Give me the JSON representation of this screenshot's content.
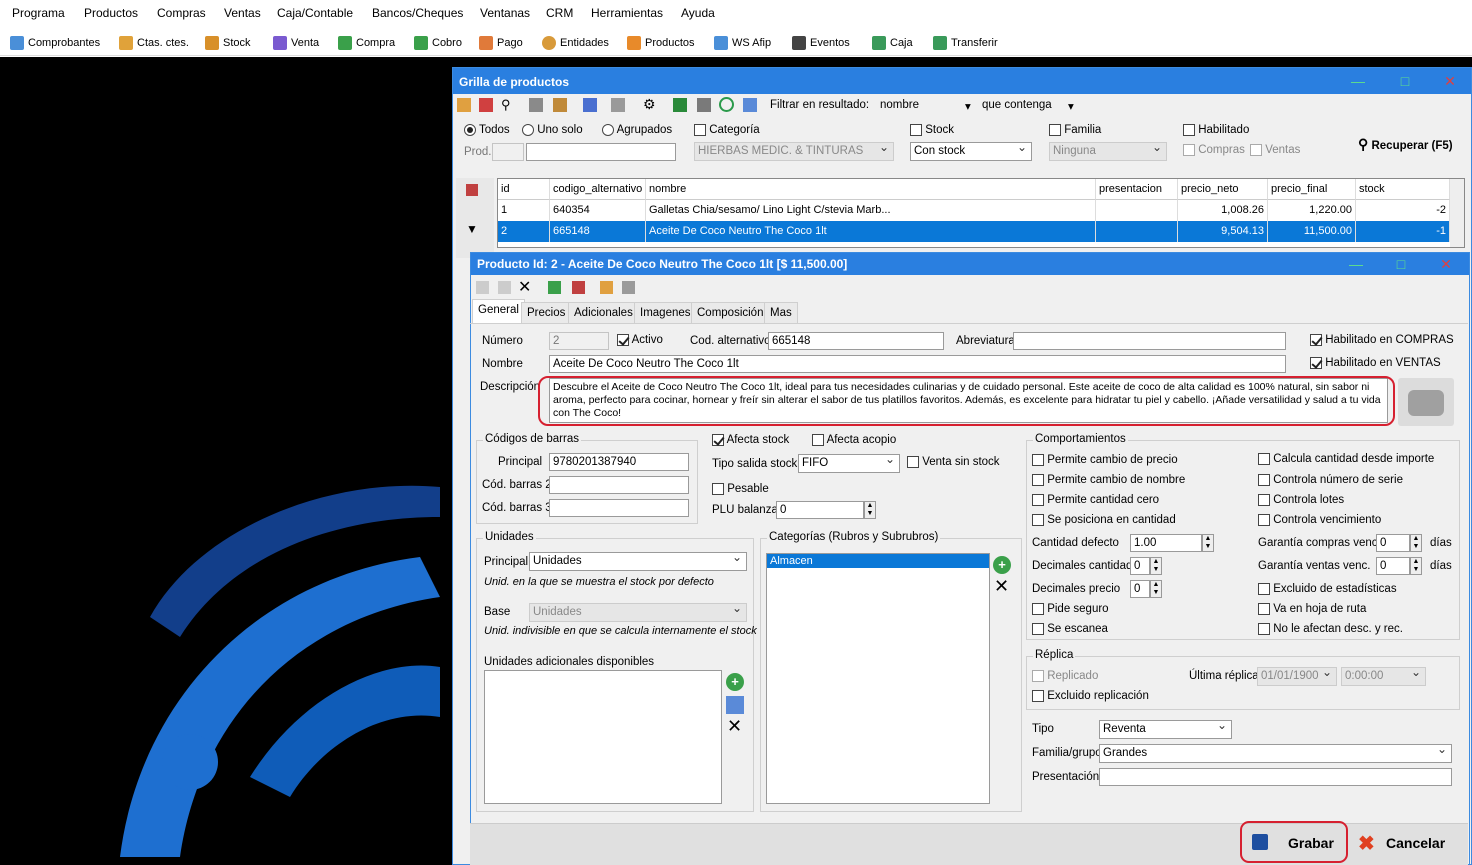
{
  "menu": [
    "Programa",
    "Productos",
    "Compras",
    "Ventas",
    "Caja/Contable",
    "Bancos/Cheques",
    "Ventanas",
    "CRM",
    "Herramientas",
    "Ayuda"
  ],
  "toolbar": [
    "Comprobantes",
    "Ctas. ctes.",
    "Stock",
    "Venta",
    "Compra",
    "Cobro",
    "Pago",
    "Entidades",
    "Productos",
    "WS Afip",
    "Eventos",
    "Caja",
    "Transferir"
  ],
  "grid_window": {
    "title": "Grilla de productos",
    "filter_label": "Filtrar en resultado:",
    "filter_field": "nombre",
    "filter_mode": "que contenga",
    "radio_todos": "Todos",
    "radio_uno": "Uno solo",
    "radio_agrupados": "Agrupados",
    "prod_label": "Prod.",
    "categoria_label": "Categoría",
    "categoria_value": "HIERBAS MEDIC. & TINTURAS",
    "stock_label": "Stock",
    "stock_value": "Con stock",
    "familia_label": "Familia",
    "familia_value": "Ninguna",
    "habilitado_label": "Habilitado",
    "compras_label": "Compras",
    "ventas_label": "Ventas",
    "recuperar": "Recuperar (F5)",
    "columns": [
      "id",
      "codigo_alternativo",
      "nombre",
      "presentacion",
      "precio_neto",
      "precio_final",
      "stock"
    ],
    "rows": [
      [
        "1",
        "640354",
        "Galletas Chia/sesamo/ Lino Light C/stevia Marb...",
        "",
        "1,008.26",
        "1,220.00",
        "-2"
      ],
      [
        "2",
        "665148",
        "Aceite De Coco Neutro The Coco 1lt",
        "",
        "9,504.13",
        "11,500.00",
        "-1"
      ]
    ]
  },
  "product": {
    "title": "Producto Id: 2 - Aceite De Coco Neutro The Coco 1lt [$ 11,500.00]",
    "tabs": [
      "General",
      "Precios",
      "Adicionales",
      "Imagenes",
      "Composición",
      "Mas"
    ],
    "numero_label": "Número",
    "numero": "2",
    "activo": "Activo",
    "cod_alt_label": "Cod. alternativo",
    "cod_alt": "665148",
    "abrev_label": "Abreviatura",
    "hab_compras": "Habilitado en COMPRAS",
    "hab_ventas": "Habilitado en VENTAS",
    "nombre_label": "Nombre",
    "nombre": "Aceite De Coco Neutro The Coco 1lt",
    "desc_label": "Descripción",
    "descripcion": "Descubre el Aceite de Coco Neutro The Coco 1lt, ideal para tus necesidades culinarias y de cuidado personal. Este aceite de coco de alta calidad es 100% natural, sin sabor ni aroma, perfecto para cocinar, hornear y freír sin alterar el sabor de tus platillos favoritos. Además, es excelente para hidratar tu piel y cabello. ¡Añade versatilidad y salud a tu vida con The Coco!",
    "barras_title": "Códigos de barras",
    "principal_label": "Principal",
    "principal": "9780201387940",
    "barras2_label": "Cód. barras 2",
    "barras3_label": "Cód. barras 3",
    "afecta_stock": "Afecta stock",
    "afecta_acopio": "Afecta acopio",
    "tipo_salida_label": "Tipo salida stock",
    "tipo_salida": "FIFO",
    "venta_sin_stock": "Venta sin stock",
    "pesable": "Pesable",
    "plu_label": "PLU balanza",
    "plu": "0",
    "unidades_title": "Unidades",
    "unid_principal_label": "Principal",
    "unid_principal": "Unidades",
    "unid_principal_hint": "Unid. en la que se muestra el stock por defecto",
    "base_label": "Base",
    "base": "Unidades",
    "base_hint": "Unid. indivisible en que se calcula internamente el stock",
    "unid_adic": "Unidades adicionales disponibles",
    "categorias_title": "Categorías (Rubros y Subrubros)",
    "categoria_item": "Almacen",
    "comport_title": "Comportamientos",
    "comport_left": [
      "Permite cambio de precio",
      "Permite cambio de nombre",
      "Permite cantidad cero",
      "Se posiciona en cantidad"
    ],
    "comport_right": [
      "Calcula cantidad desde importe",
      "Controla número de serie",
      "Controla lotes",
      "Controla vencimiento"
    ],
    "cant_defecto_label": "Cantidad defecto",
    "cant_defecto": "1.00",
    "dec_cant_label": "Decimales cantidad",
    "dec_cant": "0",
    "dec_precio_label": "Decimales precio",
    "dec_precio": "0",
    "pide_seguro": "Pide seguro",
    "se_escanea": "Se escanea",
    "gar_compras_label": "Garantía compras venc.",
    "gar_compras": "0",
    "gar_ventas_label": "Garantía ventas venc.",
    "gar_ventas": "0",
    "dias": "días",
    "excluido_est": "Excluido de estadísticas",
    "hoja_ruta": "Va en hoja de ruta",
    "no_desc": "No le afectan desc. y rec.",
    "replica_title": "Réplica",
    "replicado": "Replicado",
    "excluido_rep": "Excluido replicación",
    "ultima_label": "Última réplica:",
    "ultima_fecha": "01/01/1900",
    "ultima_hora": "0:00:00",
    "tipo_label": "Tipo",
    "tipo": "Reventa",
    "familia_label": "Familia/grupo",
    "familia": "Grandes",
    "present_label": "Presentación",
    "grabar": "Grabar",
    "cancelar": "Cancelar"
  }
}
